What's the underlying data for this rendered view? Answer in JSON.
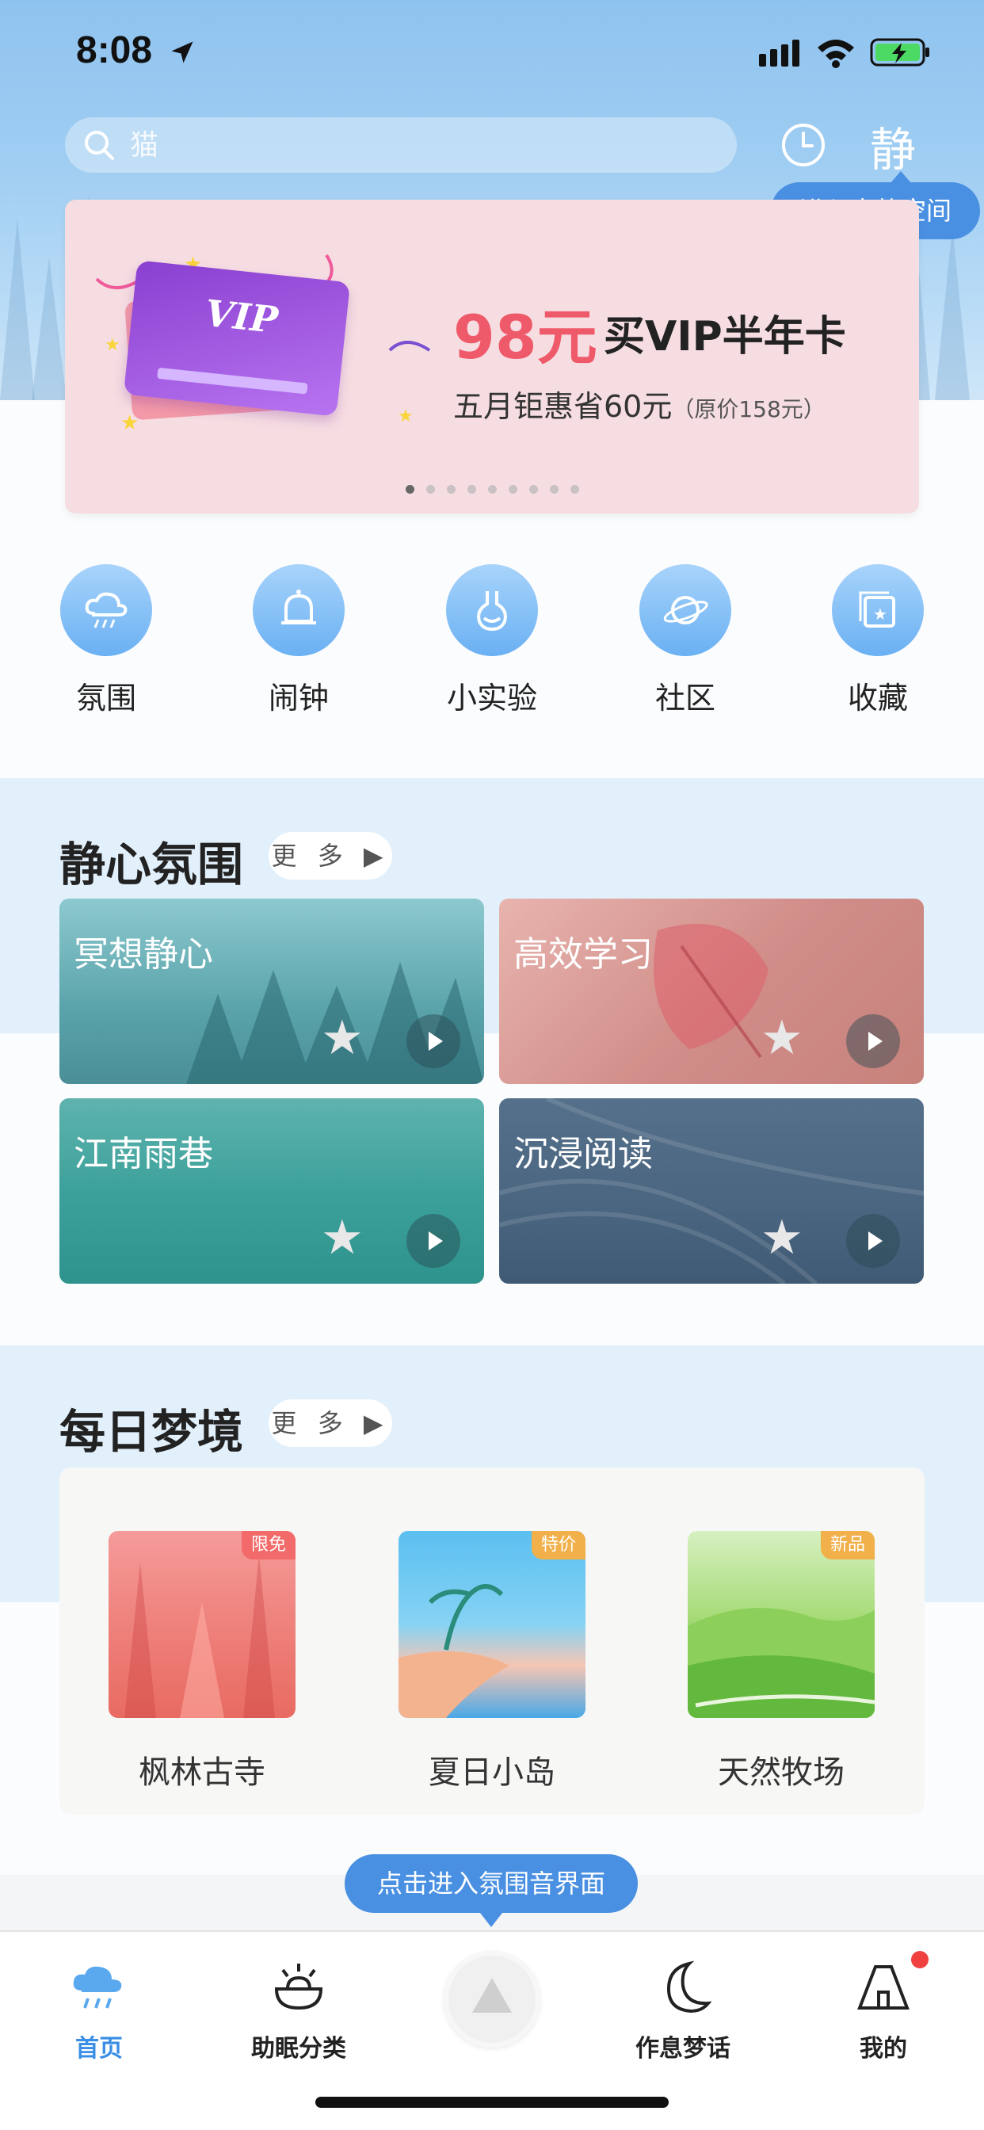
{
  "status": {
    "time": "8:08"
  },
  "search": {
    "placeholder": "猫"
  },
  "header": {
    "quiet_icon": "静",
    "quiet_tip": "进入宁静空间"
  },
  "banner": {
    "price": "98元",
    "title": "买VIP半年卡",
    "subtitle": "五月钜惠省60元",
    "original_price": "（原价158元）",
    "card_logo": "VIP",
    "page_count": 9,
    "active_page": 1
  },
  "quick_nav": [
    {
      "label": "氛围",
      "icon": "cloud-rain-icon"
    },
    {
      "label": "闹钟",
      "icon": "bell-icon"
    },
    {
      "label": "小实验",
      "icon": "flask-icon"
    },
    {
      "label": "社区",
      "icon": "planet-icon"
    },
    {
      "label": "收藏",
      "icon": "star-box-icon"
    }
  ],
  "ambience": {
    "title": "静心氛围",
    "more": "更 多 ▶",
    "cards": [
      {
        "label": "冥想静心"
      },
      {
        "label": "高效学习"
      },
      {
        "label": "江南雨巷"
      },
      {
        "label": "沉浸阅读"
      }
    ]
  },
  "dreams": {
    "title": "每日梦境",
    "more": "更 多 ▶",
    "items": [
      {
        "label": "枫林古寺",
        "badge": "限免"
      },
      {
        "label": "夏日小岛",
        "badge": "特价"
      },
      {
        "label": "天然牧场",
        "badge": "新品"
      }
    ]
  },
  "tooltip": "点击进入氛围音界面",
  "tabs": [
    {
      "label": "首页",
      "active": true
    },
    {
      "label": "助眠分类"
    },
    {
      "label": "作息梦话"
    },
    {
      "label": "我的"
    }
  ],
  "colors": {
    "accent": "#3a8ee6",
    "price": "#ef5a6a",
    "tip": "#4a90e2"
  }
}
